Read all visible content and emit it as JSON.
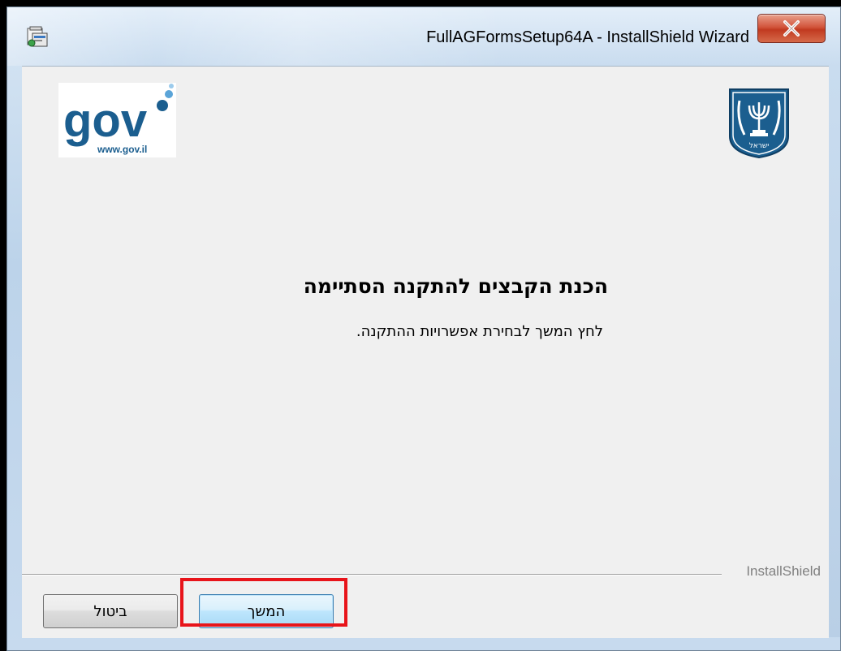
{
  "window": {
    "title": "FullAGFormsSetup64A - InstallShield Wizard",
    "close_label": "X"
  },
  "header": {
    "gov_logo_text": "gov",
    "gov_logo_url": "www.gov.il",
    "emblem_text": "ישראל"
  },
  "main": {
    "heading": "הכנת הקבצים להתקנה הסתיימה",
    "subtext": "לחץ המשך לבחירת אפשרויות ההתקנה."
  },
  "footer": {
    "brand": "InstallShield",
    "next_label": "המשך",
    "cancel_label": "ביטול"
  },
  "colors": {
    "highlight": "#e8141a",
    "gov_blue": "#1b5e8f"
  }
}
